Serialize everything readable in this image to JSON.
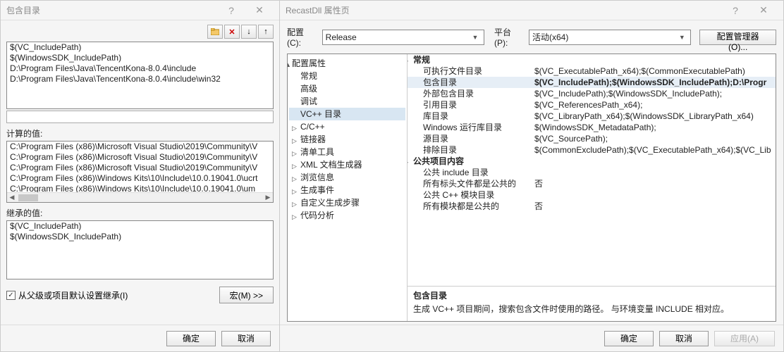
{
  "left": {
    "title": "包含目录",
    "help_icon": "?",
    "close_icon": "✕",
    "paths": [
      "$(VC_IncludePath)",
      "$(WindowsSDK_IncludePath)",
      "D:\\Program Files\\Java\\TencentKona-8.0.4\\include",
      "D:\\Program Files\\Java\\TencentKona-8.0.4\\include\\win32"
    ],
    "calculated_label": "计算的值:",
    "calculated": [
      "C:\\Program Files (x86)\\Microsoft Visual Studio\\2019\\Community\\V",
      "C:\\Program Files (x86)\\Microsoft Visual Studio\\2019\\Community\\V",
      "C:\\Program Files (x86)\\Microsoft Visual Studio\\2019\\Community\\V",
      "C:\\Program Files (x86)\\Windows Kits\\10\\Include\\10.0.19041.0\\ucrt",
      "C:\\Program Files (x86)\\Windows Kits\\10\\Include\\10.0.19041.0\\um"
    ],
    "inherited_label": "继承的值:",
    "inherited": [
      "$(VC_IncludePath)",
      "$(WindowsSDK_IncludePath)"
    ],
    "inherit_chk": "从父级或项目默认设置继承(I)",
    "macro_btn": "宏(M) >>",
    "ok": "确定",
    "cancel": "取消"
  },
  "right": {
    "title": "RecastDll 属性页",
    "cfg_label": "配置(C):",
    "cfg_value": "Release",
    "plat_label": "平台(P):",
    "plat_value": "活动(x64)",
    "cfg_mgr": "配置管理器(O)...",
    "tree_root": "配置属性",
    "tree_items": [
      "常规",
      "高级",
      "调试",
      "VC++ 目录",
      "C/C++",
      "链接器",
      "清单工具",
      "XML 文档生成器",
      "浏览信息",
      "生成事件",
      "自定义生成步骤",
      "代码分析"
    ],
    "tree_selected": "VC++ 目录",
    "groups": [
      {
        "name": "常规",
        "rows": [
          {
            "k": "可执行文件目录",
            "v": "$(VC_ExecutablePath_x64);$(CommonExecutablePath)"
          },
          {
            "k": "包含目录",
            "v": "$(VC_IncludePath);$(WindowsSDK_IncludePath);D:\\Progr",
            "sel": true
          },
          {
            "k": "外部包含目录",
            "v": "$(VC_IncludePath);$(WindowsSDK_IncludePath);"
          },
          {
            "k": "引用目录",
            "v": "$(VC_ReferencesPath_x64);"
          },
          {
            "k": "库目录",
            "v": "$(VC_LibraryPath_x64);$(WindowsSDK_LibraryPath_x64)"
          },
          {
            "k": "Windows 运行库目录",
            "v": "$(WindowsSDK_MetadataPath);"
          },
          {
            "k": "源目录",
            "v": "$(VC_SourcePath);"
          },
          {
            "k": "排除目录",
            "v": "$(CommonExcludePath);$(VC_ExecutablePath_x64);$(VC_Lib"
          }
        ]
      },
      {
        "name": "公共项目内容",
        "rows": [
          {
            "k": "公共 include 目录",
            "v": ""
          },
          {
            "k": "所有标头文件都是公共的",
            "v": "否"
          },
          {
            "k": "公共 C++ 模块目录",
            "v": ""
          },
          {
            "k": "所有模块都是公共的",
            "v": "否"
          }
        ]
      }
    ],
    "desc_title": "包含目录",
    "desc_text": "生成 VC++ 项目期间，搜索包含文件时使用的路径。   与环境变量 INCLUDE 相对应。",
    "ok": "确定",
    "cancel": "取消",
    "apply": "应用(A)"
  }
}
